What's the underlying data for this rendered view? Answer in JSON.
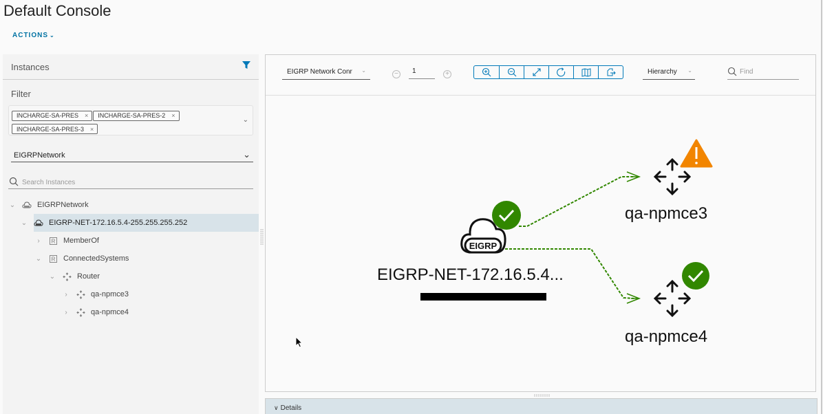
{
  "page": {
    "title": "Default Console",
    "actions_label": "ACTIONS"
  },
  "instances_panel": {
    "title": "Instances",
    "filter_label": "Filter",
    "filter_tags": [
      "INCHARGE-SA-PRES",
      "INCHARGE-SA-PRES-2",
      "INCHARGE-SA-PRES-3"
    ],
    "class_select": "EIGRPNetwork",
    "search_placeholder": "Search Instances",
    "tree": [
      {
        "label": "EIGRPNetwork",
        "icon": "eigrp-cloud-icon",
        "toggle": "expanded",
        "level": 0
      },
      {
        "label": "EIGRP-NET-172.16.5.4-255.255.255.252",
        "icon": "eigrp-cloud-icon",
        "toggle": "expanded",
        "level": 1,
        "selected": true
      },
      {
        "label": "MemberOf",
        "icon": "relationship-icon",
        "toggle": "collapsed",
        "level": 2
      },
      {
        "label": "ConnectedSystems",
        "icon": "relationship-icon",
        "toggle": "expanded",
        "level": 2
      },
      {
        "label": "Router",
        "icon": "router-icon",
        "toggle": "expanded",
        "level": 3
      },
      {
        "label": "qa-npmce3",
        "icon": "router-icon",
        "toggle": "collapsed",
        "level": 4
      },
      {
        "label": "qa-npmce4",
        "icon": "router-icon",
        "toggle": "collapsed",
        "level": 4
      }
    ]
  },
  "toolbar": {
    "view_select": "EIGRP Network Conr",
    "depth_value": "1",
    "buttons": [
      "zoom-in",
      "zoom-out",
      "fit-to-screen",
      "refresh",
      "map",
      "export"
    ],
    "layout_select": "Hierarchy",
    "find_placeholder": "Find"
  },
  "graph": {
    "nodes": [
      {
        "id": "net",
        "label": "EIGRP-NET-172.16.5.4...",
        "icon_text": "EIGRP",
        "type": "eigrp-network",
        "status": "ok",
        "selected": true
      },
      {
        "id": "r3",
        "label": "qa-npmce3",
        "type": "router",
        "status": "warning"
      },
      {
        "id": "r4",
        "label": "qa-npmce4",
        "type": "router",
        "status": "ok"
      }
    ],
    "edges": [
      {
        "from": "net",
        "to": "r3",
        "style": "dashed"
      },
      {
        "from": "net",
        "to": "r4",
        "style": "dashed"
      }
    ],
    "colors": {
      "ok": "#318700",
      "warning": "#f28500",
      "edge": "#318700",
      "accent": "#0079b8"
    }
  },
  "details": {
    "label": "Details"
  }
}
